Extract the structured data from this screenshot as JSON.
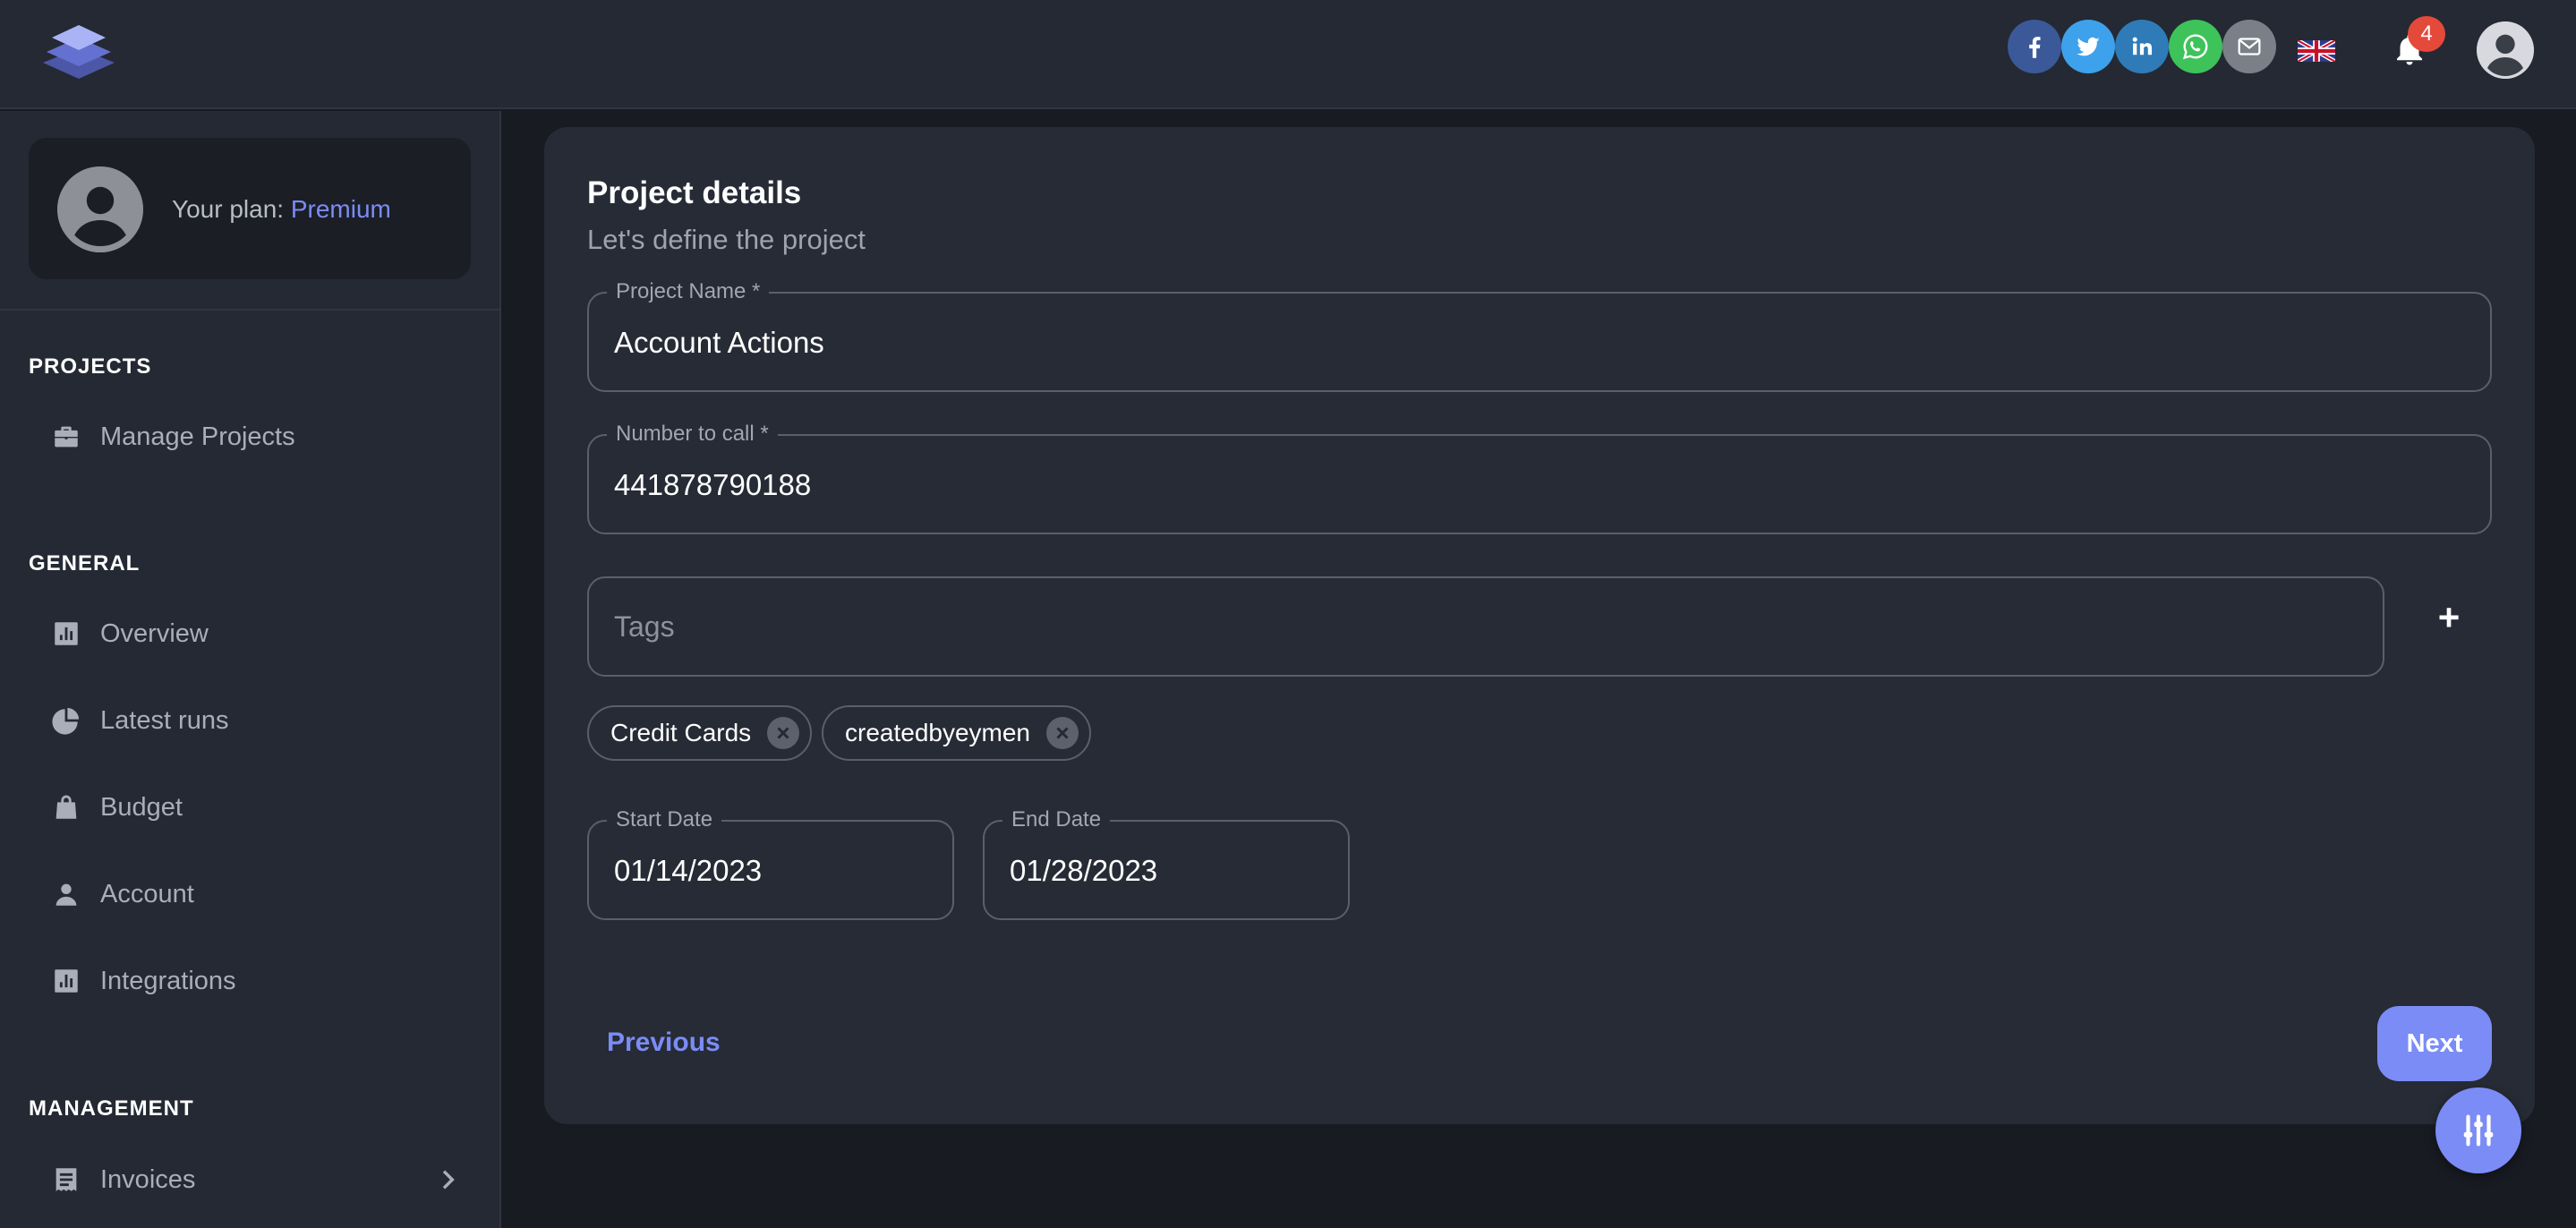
{
  "topbar": {
    "social": [
      {
        "name": "facebook-icon",
        "color": "#3b5998"
      },
      {
        "name": "twitter-icon",
        "color": "#3ea1ec"
      },
      {
        "name": "linkedin-icon",
        "color": "#2f7bb8"
      },
      {
        "name": "whatsapp-icon",
        "color": "#3dc35a"
      },
      {
        "name": "email-icon",
        "color": "#7a7f88"
      }
    ],
    "language_flag": "uk-flag-icon",
    "notification_count": "4"
  },
  "sidebar": {
    "plan_label": "Your plan: ",
    "plan_name": "Premium",
    "sections": {
      "projects": "PROJECTS",
      "general": "GENERAL",
      "management": "MANAGEMENT"
    },
    "items": {
      "manage_projects": "Manage Projects",
      "overview": "Overview",
      "latest_runs": "Latest runs",
      "budget": "Budget",
      "account": "Account",
      "integrations": "Integrations",
      "invoices": "Invoices"
    }
  },
  "main": {
    "title": "Project details",
    "subtitle": "Let's define the project",
    "project_name": {
      "label": "Project Name *",
      "value": "Account Actions"
    },
    "number_to_call": {
      "label": "Number to call *",
      "value": "441878790188"
    },
    "tags": {
      "placeholder": "Tags",
      "add_label": "+",
      "items": [
        "Credit Cards",
        "createdbyeymen"
      ]
    },
    "start_date": {
      "label": "Start Date",
      "value": "01/14/2023"
    },
    "end_date": {
      "label": "End Date",
      "value": "01/28/2023"
    },
    "previous_label": "Previous",
    "next_label": "Next"
  },
  "colors": {
    "accent": "#7b8cf6",
    "badge": "#e5493a",
    "background": "#181b22",
    "panel": "#242933",
    "card": "#262b35"
  }
}
